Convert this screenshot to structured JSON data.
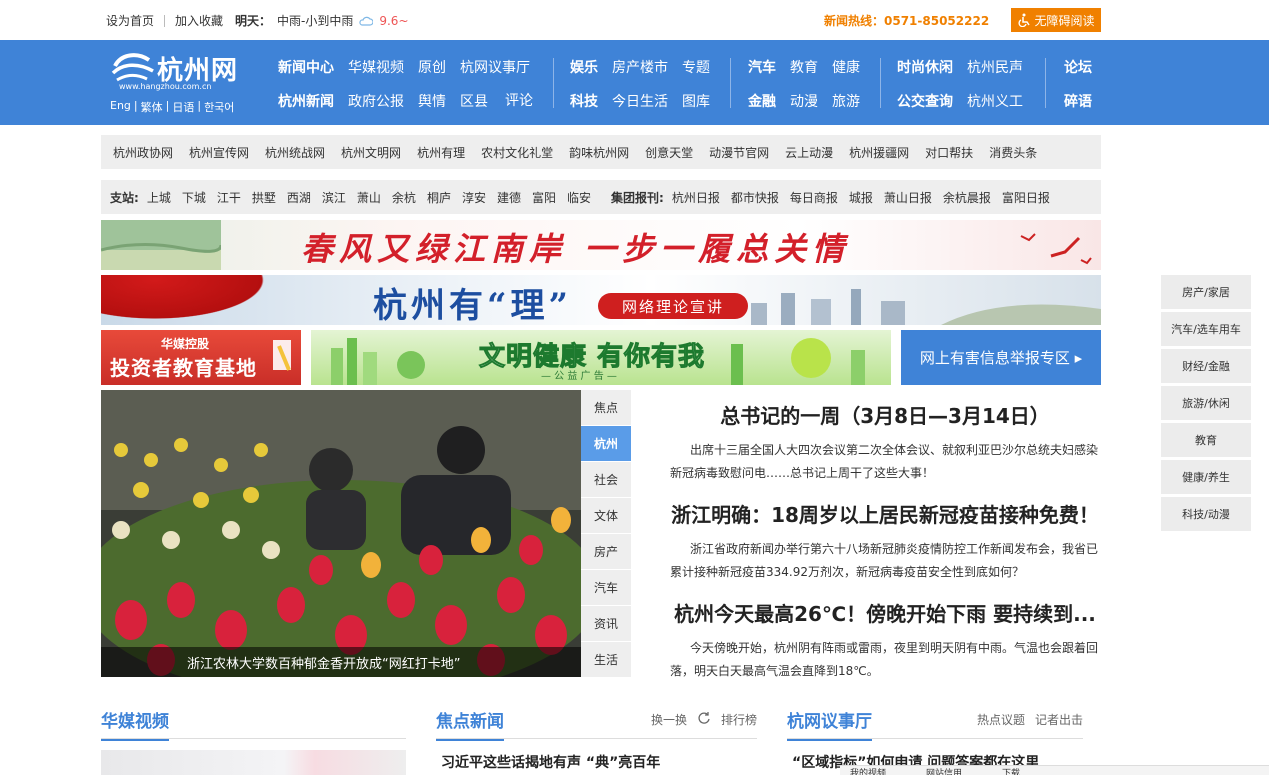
{
  "topbar": {
    "set_home": "设为首页",
    "add_fav": "加入收藏",
    "tomorrow_label": "明天：",
    "weather_text": "中雨-小到中雨",
    "temp": "9.6~",
    "hotline": "新闻热线：0571-85052222",
    "accessible": "无障碍阅读"
  },
  "logo": {
    "name": "杭州网",
    "url": "www.hangzhou.com.cn"
  },
  "langs": [
    "Eng",
    "繁体",
    "日语",
    "한국어"
  ],
  "nav": {
    "g1": [
      "新闻中心",
      "华媒视频",
      "原创",
      "杭网议事厅",
      "杭州新闻",
      "政府公报",
      "舆情",
      "区县",
      "评论"
    ],
    "g2": [
      "娱乐",
      "房产楼市",
      "专题",
      "科技",
      "今日生活",
      "图库"
    ],
    "g3": [
      "汽车",
      "教育",
      "健康",
      "金融",
      "动漫",
      "旅游"
    ],
    "g4": [
      "时尚休闲",
      "杭州民声",
      "公交查询",
      "杭州义工"
    ],
    "g5": [
      "论坛",
      "碎语"
    ]
  },
  "subnav": [
    "杭州政协网",
    "杭州宣传网",
    "杭州统战网",
    "杭州文明网",
    "杭州有理",
    "农村文化礼堂",
    "韵味杭州网",
    "创意天堂",
    "动漫节官网",
    "云上动漫",
    "杭州援疆网",
    "对口帮扶",
    "消费头条"
  ],
  "branch": {
    "label1": "支站:",
    "stations": [
      "上城",
      "下城",
      "江干",
      "拱墅",
      "西湖",
      "滨江",
      "萧山",
      "余杭",
      "桐庐",
      "淳安",
      "建德",
      "富阳",
      "临安"
    ],
    "label2": "集团报刊:",
    "papers": [
      "杭州日报",
      "都市快报",
      "每日商报",
      "城报",
      "萧山日报",
      "余杭晨报",
      "富阳日报"
    ]
  },
  "banners": {
    "b1": "春风又绿江南岸  一步一履总关情",
    "b2_title": "杭州有“理”",
    "b2_tag": "网络理论宣讲",
    "b3a_small": "华媒控股",
    "b3a_main": "投资者教育基地",
    "b3b_title": "文明健康 有你有我",
    "b3b_sub": "— 公 益 广 告 —",
    "b3c": "网上有害信息举报专区 ▸"
  },
  "photo_caption": "浙江农林大学数百种郁金香开放成“网红打卡地”",
  "tabs": [
    "焦点",
    "杭州",
    "社会",
    "文体",
    "房产",
    "汽车",
    "资讯",
    "生活"
  ],
  "tab_active": "杭州",
  "news": [
    {
      "title": "总书记的一周（3月8日—3月14日）",
      "summary": "出席十三届全国人大四次会议第二次全体会议、就叙利亚巴沙尔总统夫妇感染新冠病毒致慰问电……总书记上周干了这些大事！"
    },
    {
      "title": "浙江明确：18周岁以上居民新冠疫苗接种免费！",
      "summary": "浙江省政府新闻办举行第六十八场新冠肺炎疫情防控工作新闻发布会，我省已累计接种新冠疫苗334.92万剂次，新冠病毒疫苗安全性到底如何？"
    },
    {
      "title": "杭州今天最高26℃！傍晚开始下雨 要持续到...",
      "summary": "今天傍晚开始，杭州阴有阵雨或雷雨，夜里到明天阴有中雨。气温也会跟着回落，明天白天最高气温会直降到18℃。"
    }
  ],
  "sidebar": [
    "房产/家居",
    "汽车/选车用车",
    "财经/金融",
    "旅游/休闲",
    "教育",
    "健康/养生",
    "科技/动漫"
  ],
  "sections": [
    {
      "title": "华媒视频",
      "links": []
    },
    {
      "title": "焦点新闻",
      "links": [
        "换一换",
        "排行榜"
      ]
    },
    {
      "title": "杭网议事厅",
      "links": [
        "热点议题",
        "记者出击"
      ]
    }
  ],
  "teasers": [
    "习近平这些话揭地有声 “典”亮百年",
    "“区域指标”如何申请 问题答案都在这里"
  ],
  "statusbar": [
    "我的视频",
    "网站信用",
    "下载"
  ],
  "colors": {
    "brand_blue": "#3f83d7",
    "hotline_orange": "#f08000",
    "banner_red": "#d3202a"
  }
}
